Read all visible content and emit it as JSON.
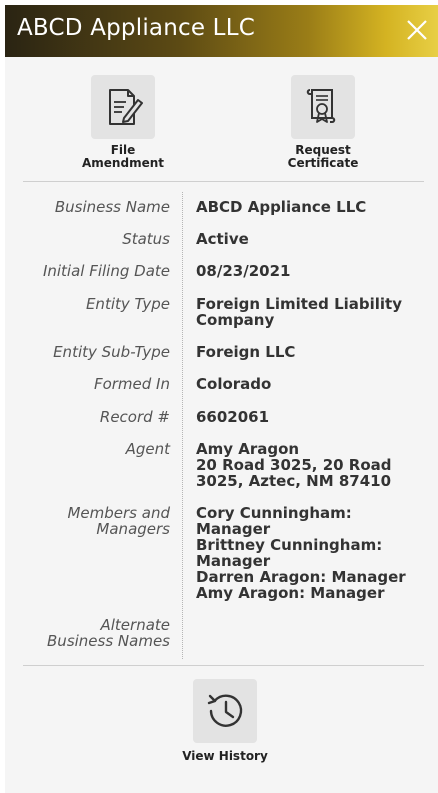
{
  "header": {
    "title": "ABCD Appliance LLC",
    "close_icon": "close-icon"
  },
  "actions": [
    {
      "label": "File\nAmendment",
      "icon": "document-edit-icon"
    },
    {
      "label": "Request\nCertificate",
      "icon": "certificate-icon"
    }
  ],
  "details": [
    {
      "key": "Business Name",
      "value": "ABCD Appliance LLC"
    },
    {
      "key": "Status",
      "value": "Active"
    },
    {
      "key": "Initial Filing Date",
      "value": "08/23/2021"
    },
    {
      "key": "Entity Type",
      "value": "Foreign Limited Liability\nCompany"
    },
    {
      "key": "Entity Sub-Type",
      "value": "Foreign LLC"
    },
    {
      "key": "Formed In",
      "value": "Colorado"
    },
    {
      "key": "Record #",
      "value": "6602061"
    },
    {
      "key": "Agent",
      "value": "Amy Aragon\n20 Road 3025, 20 Road\n3025, Aztec, NM 87410"
    },
    {
      "key": "Members and\nManagers",
      "value": "Cory Cunningham:\nManager\nBrittney Cunningham:\nManager\nDarren Aragon: Manager\nAmy Aragon: Manager"
    },
    {
      "key": "Alternate\nBusiness Names",
      "value": ""
    }
  ],
  "history": {
    "label": "View History",
    "icon": "history-clock-icon"
  },
  "colors": {
    "header_gradient_start": "#2a2413",
    "header_gradient_end": "#e8cf45",
    "panel_background": "#f5f5f5",
    "icon_box": "#e3e3e3"
  }
}
